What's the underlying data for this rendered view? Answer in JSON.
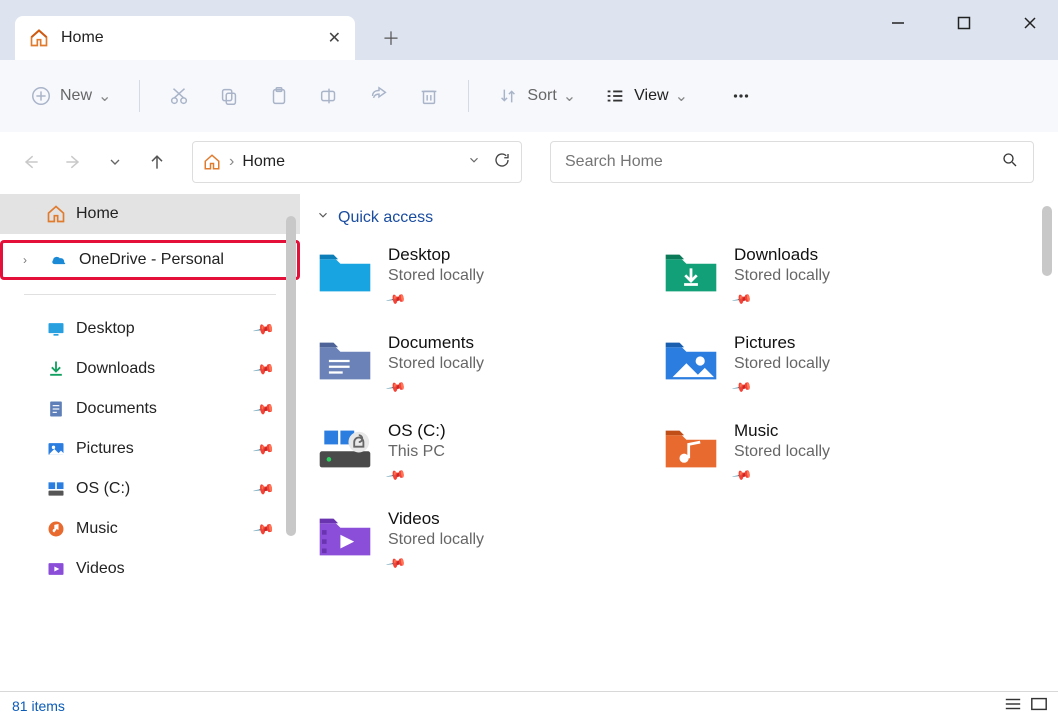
{
  "window": {
    "tab_title": "Home",
    "search_placeholder": "Search Home"
  },
  "toolbar": {
    "new_label": "New",
    "sort_label": "Sort",
    "view_label": "View"
  },
  "address": {
    "location": "Home"
  },
  "sidebar": {
    "home": "Home",
    "onedrive": "OneDrive - Personal",
    "items": [
      {
        "label": "Desktop"
      },
      {
        "label": "Downloads"
      },
      {
        "label": "Documents"
      },
      {
        "label": "Pictures"
      },
      {
        "label": "OS (C:)"
      },
      {
        "label": "Music"
      },
      {
        "label": "Videos"
      }
    ]
  },
  "content": {
    "section": "Quick access",
    "tiles": [
      {
        "title": "Desktop",
        "sub": "Stored locally"
      },
      {
        "title": "Downloads",
        "sub": "Stored locally"
      },
      {
        "title": "Documents",
        "sub": "Stored locally"
      },
      {
        "title": "Pictures",
        "sub": "Stored locally"
      },
      {
        "title": "OS (C:)",
        "sub": "This PC"
      },
      {
        "title": "Music",
        "sub": "Stored locally"
      },
      {
        "title": "Videos",
        "sub": "Stored locally"
      }
    ]
  },
  "status": {
    "items": "81 items"
  }
}
